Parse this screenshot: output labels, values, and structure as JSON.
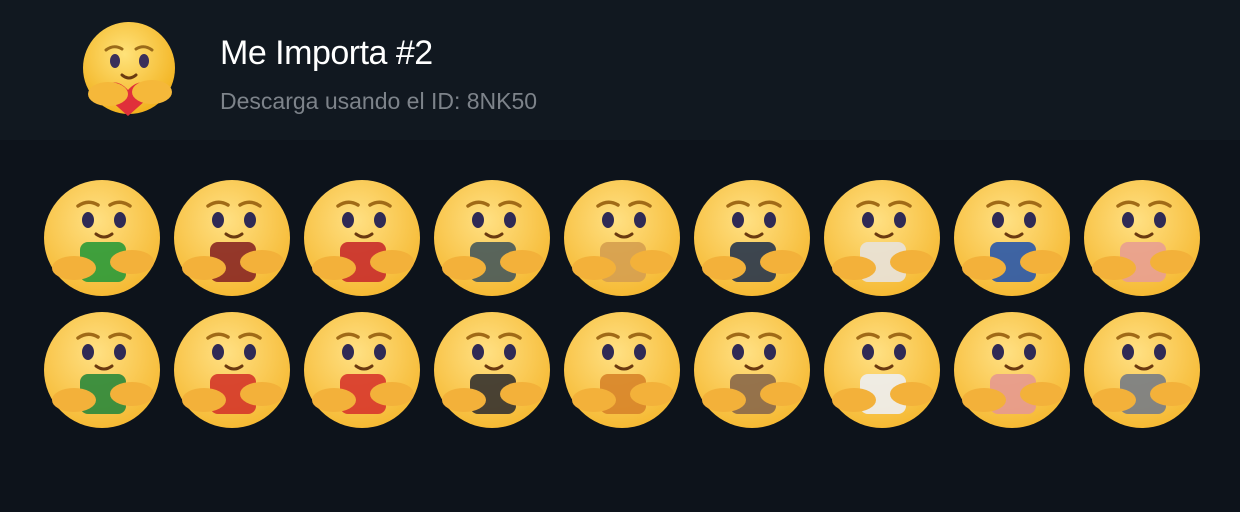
{
  "pack": {
    "title": "Me Importa #2",
    "subtitle": "Descarga usando el ID: 8NK50",
    "icon": "care-emoji-hugging-heart-icon"
  },
  "colors": {
    "background": "#0d131b",
    "header": "#111820",
    "face": "#f7c340",
    "title": "#ffffff",
    "subtitle": "#7d838a"
  },
  "stickers": [
    {
      "icon": "care-emoji-green-cap-sticker",
      "accent": "#2f9b3a"
    },
    {
      "icon": "care-emoji-anatomical-heart-sticker",
      "accent": "#8b2a25"
    },
    {
      "icon": "care-emoji-beer-bottle-sticker",
      "accent": "#c9302c"
    },
    {
      "icon": "care-emoji-smartphone-sticker",
      "accent": "#4b5b5a"
    },
    {
      "icon": "care-emoji-doge-sticker",
      "accent": "#d6a04f"
    },
    {
      "icon": "care-emoji-passport-sticker",
      "accent": "#2c3a4d"
    },
    {
      "icon": "care-emoji-lemur-sticker",
      "accent": "#e8e2d8"
    },
    {
      "icon": "care-emoji-beer-box-sticker",
      "accent": "#2e5aa8"
    },
    {
      "icon": "care-emoji-peach-sticker",
      "accent": "#e8a090"
    },
    {
      "icon": "care-emoji-beer-bottles-sticker",
      "accent": "#2f8a3c"
    },
    {
      "icon": "care-emoji-cigarette-pack-sticker",
      "accent": "#d53a2a"
    },
    {
      "icon": "care-emoji-red-hat-sticker",
      "accent": "#d83a2c"
    },
    {
      "icon": "care-emoji-man-portrait-sticker",
      "accent": "#3a3530"
    },
    {
      "icon": "care-emoji-two-beers-sticker",
      "accent": "#d8862a"
    },
    {
      "icon": "care-emoji-bread-sticker",
      "accent": "#8c6a4a"
    },
    {
      "icon": "care-emoji-game-controller-sticker",
      "accent": "#eeeeee"
    },
    {
      "icon": "care-emoji-pink-figure-sticker",
      "accent": "#e69a8e"
    },
    {
      "icon": "care-emoji-grey-sphere-sticker",
      "accent": "#7a7e84"
    }
  ]
}
